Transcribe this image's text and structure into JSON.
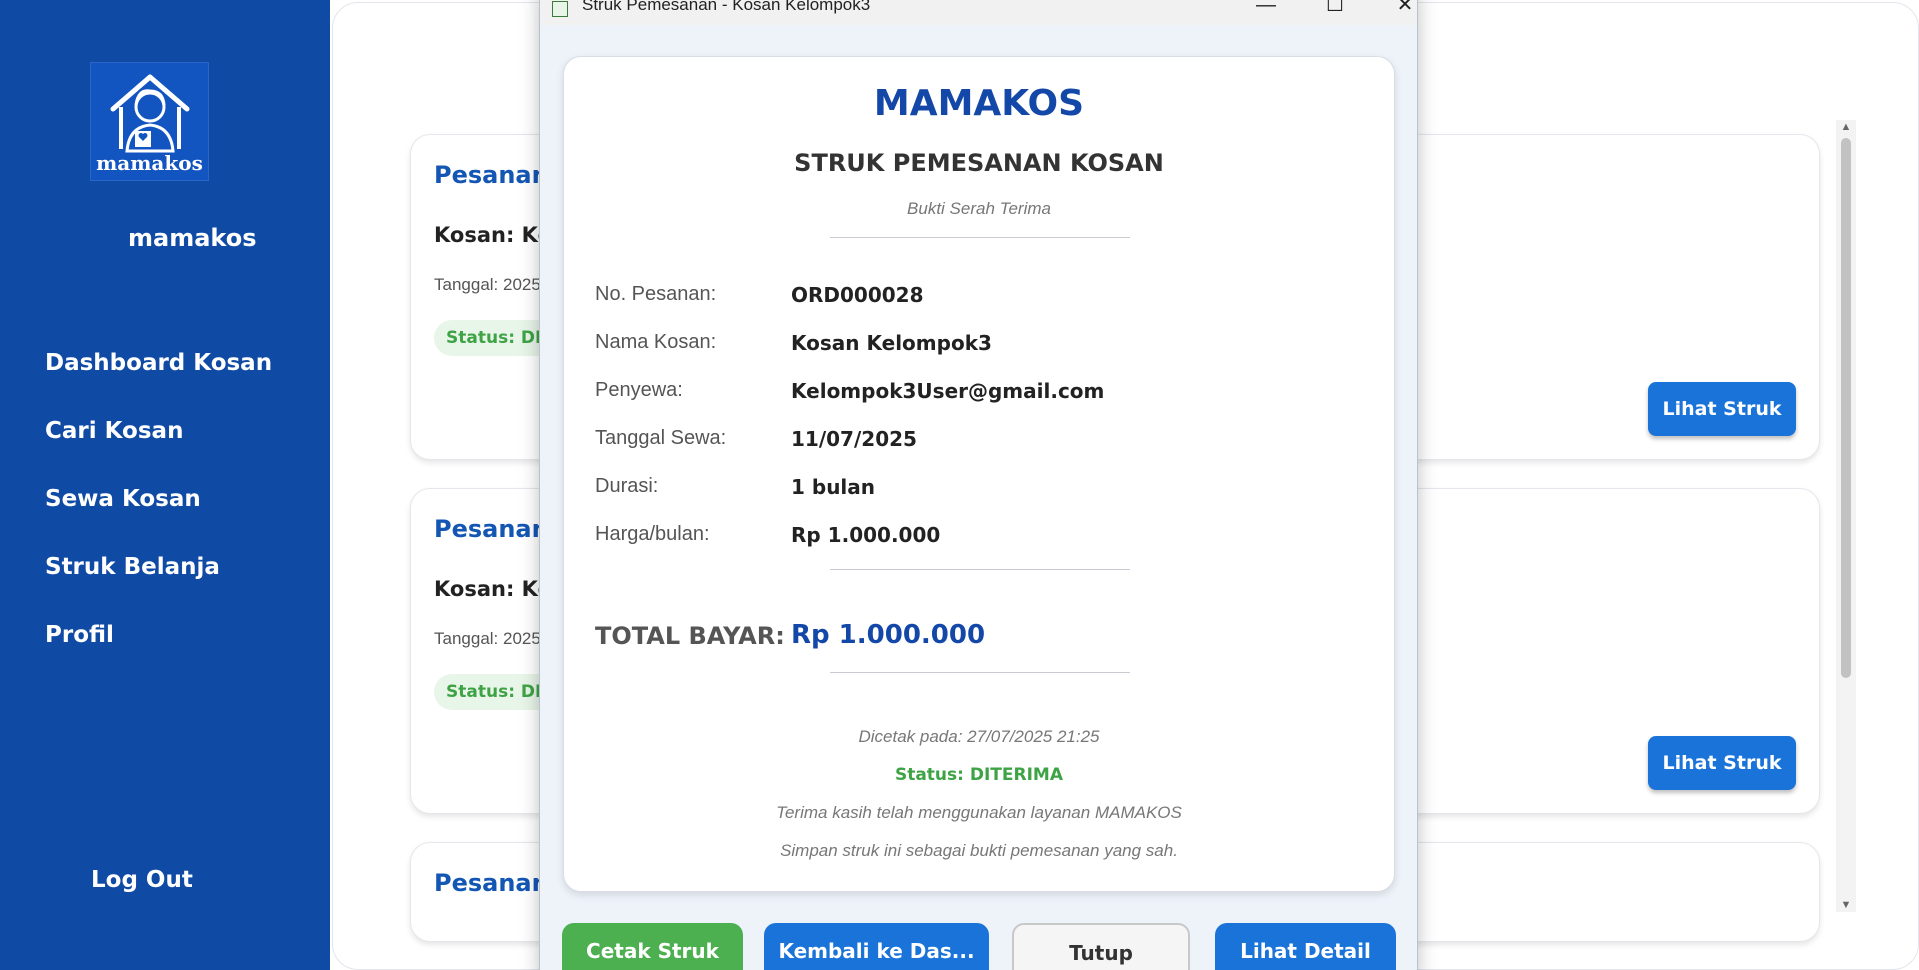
{
  "sidebar": {
    "logo_text": "mamakos",
    "brand": "mamakos",
    "nav": [
      "Dashboard Kosan",
      "Cari Kosan",
      "Sewa Kosan",
      "Struk Belanja",
      "Profil"
    ],
    "logout": "Log Out"
  },
  "orders": [
    {
      "title": "Pesanan #",
      "kosan": "Kosan: Kos",
      "date": "Tanggal: 2025",
      "status": "Status: DIT",
      "button": "Lihat Struk"
    },
    {
      "title": "Pesanan #",
      "kosan": "Kosan: Kos",
      "date": "Tanggal: 2025",
      "status": "Status: DIT",
      "button": "Lihat Struk"
    },
    {
      "title": "Pesanan #"
    }
  ],
  "dialog": {
    "window_title": "Struk Pemesanan - Kosan Kelompok3",
    "brand": "MAMAKOS",
    "title": "STRUK PEMESANAN KOSAN",
    "subtitle": "Bukti Serah Terima",
    "rows": [
      {
        "label": "No. Pesanan:",
        "value": "ORD000028"
      },
      {
        "label": "Nama Kosan:",
        "value": "Kosan Kelompok3"
      },
      {
        "label": "Penyewa:",
        "value": "Kelompok3User@gmail.com"
      },
      {
        "label": "Tanggal Sewa:",
        "value": "11/07/2025"
      },
      {
        "label": "Durasi:",
        "value": "1 bulan"
      },
      {
        "label": "Harga/bulan:",
        "value": "Rp 1.000.000"
      }
    ],
    "total_label": "TOTAL BAYAR:",
    "total_value": "Rp 1.000.000",
    "printed": "Dicetak pada: 27/07/2025 21:25",
    "status": "Status: DITERIMA",
    "thanks": "Terima kasih telah menggunakan layanan MAMAKOS",
    "keep": "Simpan struk ini sebagai bukti pemesanan yang sah.",
    "buttons": {
      "print": "Cetak Struk",
      "back": "Kembali ke Das...",
      "close": "Tutup",
      "detail": "Lihat Detail"
    },
    "colors": {
      "primary": "#1a73d9",
      "success": "#4caf50",
      "brand": "#1448a8"
    }
  },
  "colors": {
    "sidebar": "#0f4aa5",
    "status_green": "#3ea344"
  }
}
